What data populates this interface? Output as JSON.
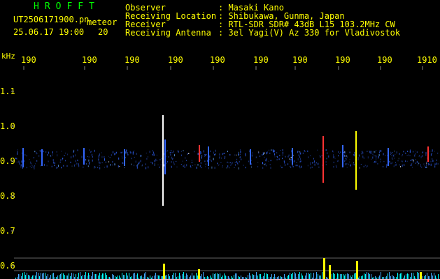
{
  "logo": "HROFFT",
  "file": {
    "name": "UT2506171900.pn",
    "mode": "meteor",
    "datetime": "25.06.17 19:00",
    "count": "20"
  },
  "info": {
    "labels": [
      "Observer",
      "Receiving Location",
      "Receiver",
      "Receiving Antenna"
    ],
    "values": [
      ": Masaki Kano",
      ": Shibukawa, Gunma, Japan",
      ": RTL-SDR SDR# 43dB L15 103.2MHz CW",
      ": 3el Yagi(V) Az 330 for Vladivostok"
    ]
  },
  "axis": {
    "y_unit": "kHz",
    "y_ticks": [
      "1.1",
      "1.0",
      "0.9",
      "0.8",
      "0.7",
      "0.6"
    ],
    "x_ticks": [
      "190",
      "190",
      "190",
      "190",
      "190",
      "190",
      "190",
      "190",
      "190",
      "1910"
    ]
  },
  "colors": {
    "text": "#ffff00",
    "logo": "#00ff00",
    "grid": "#444444",
    "background": "#000000",
    "signal_blue": "#3366ff",
    "signal_red": "#ff3333",
    "signal_yellow": "#ffff00",
    "signal_cyan": "#00ffff"
  }
}
